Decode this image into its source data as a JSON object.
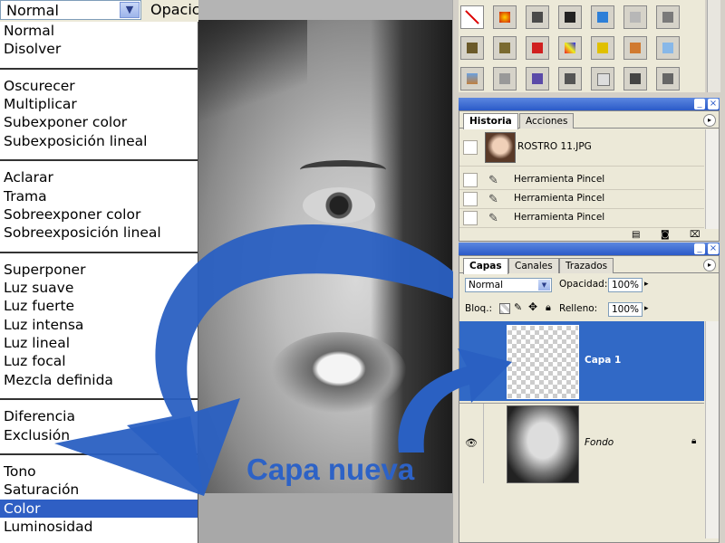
{
  "blend_mode_dropdown": {
    "selected_value": "Normal",
    "opacity_label": "Opacic",
    "groups": [
      [
        "Normal",
        "Disolver"
      ],
      [
        "Oscurecer",
        "Multiplicar",
        "Subexponer color",
        "Subexposición lineal"
      ],
      [
        "Aclarar",
        "Trama",
        "Sobreexponer color",
        "Sobreexposición lineal"
      ],
      [
        "Superponer",
        "Luz suave",
        "Luz fuerte",
        "Luz intensa",
        "Luz lineal",
        "Luz focal",
        "Mezcla definida"
      ],
      [
        "Diferencia",
        "Exclusión"
      ],
      [
        "Tono",
        "Saturación",
        "Color",
        "Luminosidad"
      ]
    ],
    "highlighted_item": "Color"
  },
  "history_panel": {
    "tabs": [
      "Historia",
      "Acciones"
    ],
    "active_tab": "Historia",
    "snapshot": "ROSTRO 11.JPG",
    "steps": [
      "Herramienta Pincel",
      "Herramienta Pincel",
      "Herramienta Pincel"
    ]
  },
  "layers_panel": {
    "tabs": [
      "Capas",
      "Canales",
      "Trazados"
    ],
    "active_tab": "Capas",
    "blend_mode": "Normal",
    "opacity_label": "Opacidad:",
    "opacity_value": "100%",
    "lock_label": "Bloq.:",
    "fill_label": "Relleno:",
    "fill_value": "100%",
    "layers": [
      {
        "name": "Capa 1",
        "selected": true
      },
      {
        "name": "Fondo",
        "selected": false
      }
    ]
  },
  "annotation": {
    "caption": "Capa nueva",
    "color": "#2d62c6"
  },
  "colors": {
    "selection": "#2f5fc4",
    "panel_title": "#2b5ac8",
    "panel_bg": "#ece9d8"
  },
  "icons": [
    "chevron-down-icon",
    "eye-icon",
    "lock-icon",
    "brush-icon",
    "menu-arrow-icon",
    "trash-icon",
    "new-snapshot-icon",
    "camera-icon",
    "minimize-icon",
    "close-icon"
  ]
}
